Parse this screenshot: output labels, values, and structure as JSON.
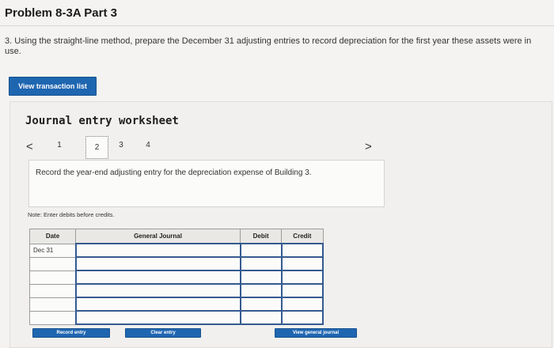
{
  "header": {
    "title": "Problem 8-3A Part 3"
  },
  "question": {
    "text": "3. Using the straight-line method, prepare the December 31 adjusting entries to record depreciation for the first year these assets were in use."
  },
  "buttons": {
    "view_transaction_list": "View transaction list",
    "record_entry": "Record entry",
    "clear_entry": "Clear entry",
    "view_general_journal": "View general journal"
  },
  "worksheet": {
    "title": "Journal entry worksheet",
    "pager": {
      "prev": "<",
      "next": ">",
      "pages": [
        "1",
        "2",
        "3",
        "4"
      ],
      "active": "2"
    },
    "prompt": "Record the year-end adjusting entry for the depreciation expense of Building 3.",
    "note": "Note: Enter debits before credits.",
    "table": {
      "headers": {
        "date": "Date",
        "general_journal": "General Journal",
        "debit": "Debit",
        "credit": "Credit"
      },
      "rows": [
        {
          "date": "Dec 31",
          "account": "",
          "debit": "",
          "credit": ""
        },
        {
          "date": "",
          "account": "",
          "debit": "",
          "credit": ""
        },
        {
          "date": "",
          "account": "",
          "debit": "",
          "credit": ""
        },
        {
          "date": "",
          "account": "",
          "debit": "",
          "credit": ""
        },
        {
          "date": "",
          "account": "",
          "debit": "",
          "credit": ""
        },
        {
          "date": "",
          "account": "",
          "debit": "",
          "credit": ""
        }
      ]
    }
  },
  "colors": {
    "accent": "#1f66b1",
    "background": "#f4f3f1"
  }
}
